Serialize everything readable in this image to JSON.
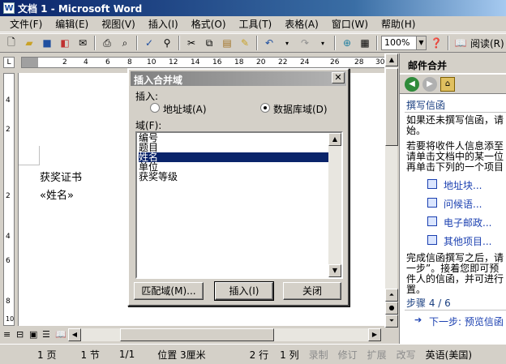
{
  "window": {
    "title": "文档 1 - Microsoft Word",
    "app_icon": "W"
  },
  "menu": [
    "文件(F)",
    "编辑(E)",
    "视图(V)",
    "插入(I)",
    "格式(O)",
    "工具(T)",
    "表格(A)",
    "窗口(W)",
    "帮助(H)"
  ],
  "toolbar": {
    "zoom": "100%",
    "read_label": "阅读(R)"
  },
  "ruler": {
    "ticks": [
      "2",
      "4",
      "6",
      "8",
      "10",
      "12",
      "14",
      "16",
      "18",
      "20",
      "22",
      "24",
      "26",
      "28",
      "30"
    ]
  },
  "vruler": {
    "ticks": [
      "4",
      "2",
      "2",
      "4",
      "6",
      "8",
      "10"
    ]
  },
  "document": {
    "line1": "获奖证书",
    "line2": "«姓名»"
  },
  "dialog": {
    "title": "插入合并域",
    "insert_label": "插入:",
    "radio_address": "地址域(A)",
    "radio_database": "数据库域(D)",
    "fields_label": "域(F):",
    "fields": [
      "编号",
      "题目",
      "姓名",
      "单位",
      "获奖等级"
    ],
    "selected_field": "姓名",
    "btn_match": "匹配域(M)...",
    "btn_insert": "插入(I)",
    "btn_close": "关闭"
  },
  "taskpane": {
    "title": "邮件合并",
    "section": "撰写信函",
    "para1_line1": "如果还未撰写信函，请",
    "para1_line2": "始。",
    "para2_line1": "若要将收件人信息添至",
    "para2_line2": "请单击文档中的某一位",
    "para2_line3": "再单击下列的一个项目",
    "links": [
      "地址块...",
      "问候语...",
      "电子邮政...",
      "其他项目..."
    ],
    "para3_line1": "完成信函撰写之后，请",
    "para3_line2": "一步”。接着您即可预",
    "para3_line3": "件人的信函，并可进行",
    "para3_line4": "置。",
    "step": "步骤 4 / 6",
    "next": "下一步: 预览信函"
  },
  "status": {
    "page": "1 页",
    "section": "1 节",
    "pages": "1/1",
    "position": "位置 3厘米",
    "line": "2 行",
    "column": "1 列",
    "rec": "录制",
    "trk": "修订",
    "ext": "扩展",
    "ovr": "改写",
    "lang": "英语(美国)"
  }
}
